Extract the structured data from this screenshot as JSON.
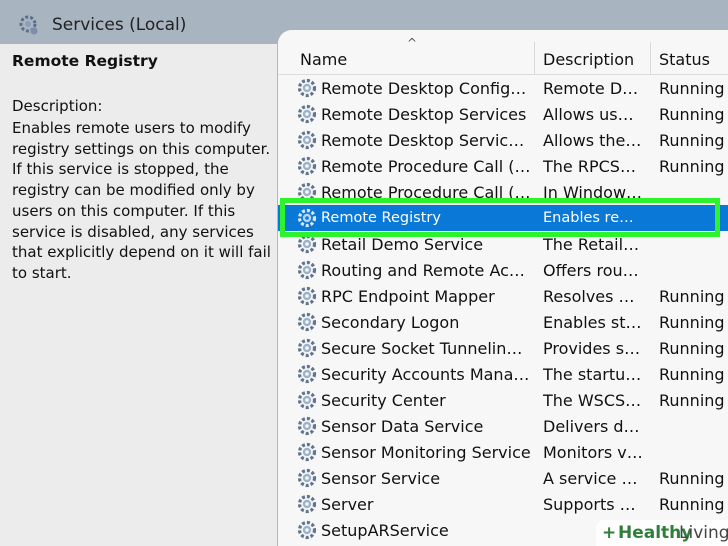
{
  "window": {
    "title": "Services (Local)",
    "accent_color": "#0a78d7",
    "highlight_color": "#2cf32c"
  },
  "details": {
    "service_title": "Remote Registry",
    "description_label": "Description:",
    "description_text": "Enables remote users to modify registry settings on this computer. If this service is stopped, the registry can be modified only by users on this computer. If this service is disabled, any services that explicitly depend on it will fail to start."
  },
  "columns": {
    "name": "Name",
    "description": "Description",
    "status": "Status",
    "sort_indicator": "^"
  },
  "services": [
    {
      "name": "Remote Desktop Configurati...",
      "description": "Remote Des...",
      "status": "Running"
    },
    {
      "name": "Remote Desktop Services",
      "description": "Allows users ...",
      "status": "Running"
    },
    {
      "name": "Remote Desktop Services Us...",
      "description": "Allows the re...",
      "status": "Running"
    },
    {
      "name": "Remote Procedure Call (RPC)",
      "description": "The RPCSS s...",
      "status": "Running"
    },
    {
      "name": "Remote Procedure Call (RPC)",
      "description": "In Windows ...",
      "status": ""
    },
    {
      "name": "Remote Registry",
      "description": "Enables rem...",
      "status": "",
      "selected": true
    },
    {
      "name": "Retail Demo Service",
      "description": "The Retail D...",
      "status": ""
    },
    {
      "name": "Routing and Remote Access",
      "description": "Offers routi...",
      "status": ""
    },
    {
      "name": "RPC Endpoint Mapper",
      "description": "Resolves RP...",
      "status": "Running"
    },
    {
      "name": "Secondary Logon",
      "description": "Enables start...",
      "status": "Running"
    },
    {
      "name": "Secure Socket Tunneling Pro...",
      "description": "Provides sup...",
      "status": "Running"
    },
    {
      "name": "Security Accounts Manager",
      "description": "The startup ...",
      "status": "Running"
    },
    {
      "name": "Security Center",
      "description": "The WSCSVC...",
      "status": "Running"
    },
    {
      "name": "Sensor Data Service",
      "description": "Delivers dat...",
      "status": ""
    },
    {
      "name": "Sensor Monitoring Service",
      "description": "Monitors va...",
      "status": ""
    },
    {
      "name": "Sensor Service",
      "description": "A service for ...",
      "status": "Running"
    },
    {
      "name": "Server",
      "description": "Supports file...",
      "status": "Running"
    },
    {
      "name": "SetupARService",
      "description": "",
      "status": ""
    }
  ],
  "watermark": {
    "plus": "+",
    "text_a": "Healthy",
    "text_b": "Living"
  }
}
